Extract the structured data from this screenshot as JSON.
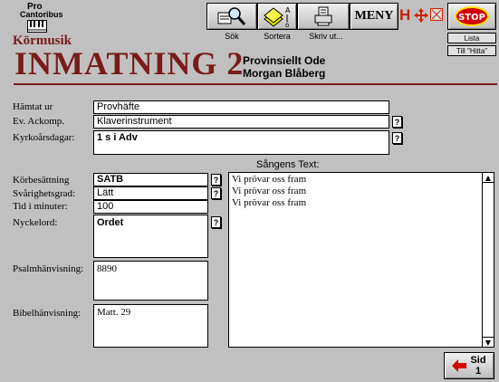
{
  "logo": {
    "line1": "Pro",
    "line2": "Cantoribus"
  },
  "header": {
    "subtitle": "Körmusik",
    "title": "INMATNING 2",
    "song_title": "Provinsiellt Ode",
    "composer": "Morgan Blåberg"
  },
  "toolbar": {
    "search_label": "Sök",
    "sort_label": "Sortera",
    "print_label": "Skriv ut...",
    "menu_label": "MENY",
    "h_label": "H",
    "stop_label": "STOP",
    "list_label": "Lista",
    "goto_find_label": "Till \"Hitta\""
  },
  "form": {
    "fetched_from": {
      "label": "Hämtat ur",
      "value": "Provhäfte"
    },
    "accompaniment": {
      "label": "Ev. Ackomp.",
      "value": "Klaverinstrument"
    },
    "church_days": {
      "label": "Kyrkoårsdagar:",
      "value": "1 s i Adv"
    },
    "voicing": {
      "label": "Körbesättning",
      "value": "SATB"
    },
    "difficulty": {
      "label": "Svårighetsgrad:",
      "value": "Lätt"
    },
    "duration": {
      "label": "Tid i minuter:",
      "value": "100"
    },
    "keywords": {
      "label": "Nyckelord:",
      "value": "Ordet"
    },
    "psalm_ref": {
      "label": "Psalmhänvisning:",
      "value": "8890"
    },
    "bible_ref": {
      "label": "Bibelhänvisning:",
      "value": "Matt. 29"
    },
    "help_glyph": "?"
  },
  "lyrics": {
    "label": "Sångens Text:",
    "lines": [
      "Vi prövar oss fram",
      "Vi prövar oss fram",
      "Vi prövar oss fram"
    ]
  },
  "page_button": {
    "label": "Sid",
    "number": "1"
  },
  "colors": {
    "title": "#7a1a1a",
    "background": "#c0c0c0",
    "stop": "#d40000"
  }
}
